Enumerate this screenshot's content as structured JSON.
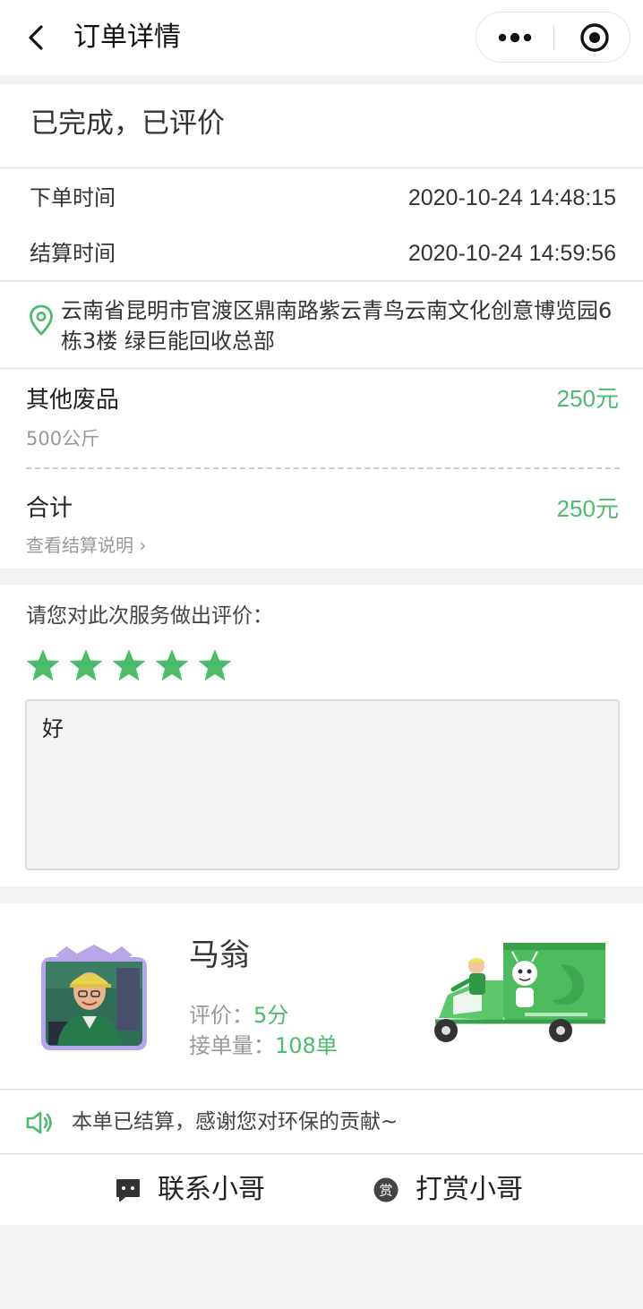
{
  "navbar": {
    "title": "订单详情"
  },
  "order": {
    "status": "已完成，已评价",
    "times": [
      {
        "label": "下单时间",
        "value": "2020-10-24 14:48:15"
      },
      {
        "label": "结算时间",
        "value": "2020-10-24 14:59:56"
      }
    ],
    "address": "云南省昆明市官渡区鼎南路紫云青鸟云南文化创意博览园6栋3楼 绿巨能回收总部"
  },
  "items": {
    "item_name": "其他废品",
    "item_weight": "500公斤",
    "item_price": "250元",
    "total_label": "合计",
    "total_price": "250元",
    "settle_link": "查看结算说明 ›"
  },
  "rating": {
    "prompt": "请您对此次服务做出评价：",
    "stars": 5,
    "max_stars": 5,
    "comment": "好"
  },
  "courier": {
    "name": "马翁",
    "rating_label": "评价：",
    "rating_value": "5分",
    "orders_label": "接单量：",
    "orders_value": "108单"
  },
  "notice": "本单已结算，感谢您对环保的贡献~",
  "actions": {
    "contact_label": "联系小哥",
    "tip_label": "打赏小哥",
    "tip_icon_text": "赏"
  },
  "colors": {
    "accent": "#4dbb6b",
    "background": "#f2f2f2"
  }
}
